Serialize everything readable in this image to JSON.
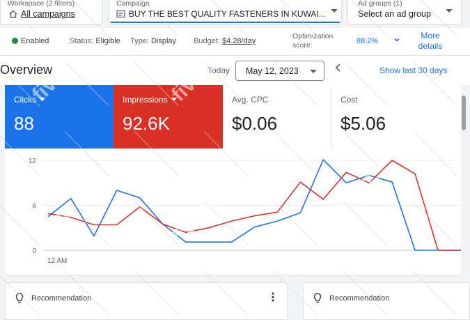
{
  "selectors": {
    "workspace": {
      "caption": "Workspace (2 filters)",
      "value": "All campaigns"
    },
    "campaign": {
      "caption": "Campaign",
      "value": "BUY THE BEST QUALITY FASTENERS IN KUWAI..."
    },
    "ad_groups": {
      "caption": "Ad groups (1)",
      "value": "Select an ad group"
    }
  },
  "status": {
    "enabled": "Enabled",
    "status_label": "Status:",
    "status_value": "Eligible",
    "type_label": "Type:",
    "type_value": "Display",
    "budget_label": "Budget:",
    "budget_value": "$4.28/day",
    "optimization_label": "Optimization score:",
    "optimization_value": "88.2%",
    "more_details": "More details"
  },
  "overview": {
    "title": "Overview",
    "today": "Today",
    "date": "May 12, 2023",
    "show_last": "Show last 30 days"
  },
  "metrics": [
    {
      "label": "Clicks",
      "value": "88"
    },
    {
      "label": "Impressions",
      "value": "92.6K"
    },
    {
      "label": "Avg. CPC",
      "value": "$0.06"
    },
    {
      "label": "Cost",
      "value": "$5.06"
    }
  ],
  "colors": {
    "clicks": "#1a73e8",
    "impressions": "#d93025",
    "enabled": "#1e8e3e",
    "link": "#1a73e8"
  },
  "chart_data": {
    "type": "line",
    "x": [
      0,
      1,
      2,
      3,
      4,
      5,
      6,
      7,
      8,
      9,
      10,
      11,
      12,
      13,
      14,
      15,
      16,
      17,
      18
    ],
    "xlabel_first": "12 AM",
    "yticks": [
      "12",
      "6",
      "0"
    ],
    "ylim": [
      0,
      12
    ],
    "grid": true,
    "series": [
      {
        "name": "Clicks",
        "values": [
          4.5,
          6.9,
          1.9,
          8.0,
          7.0,
          3.5,
          1.1,
          1.1,
          1.1,
          3.1,
          3.9,
          5.0,
          12.1,
          9.0,
          10.0,
          9.1,
          0,
          0,
          0
        ]
      },
      {
        "name": "Impressions",
        "values": [
          4.9,
          4.4,
          3.4,
          3.4,
          5.8,
          3.5,
          2.4,
          3.0,
          3.9,
          4.6,
          5.1,
          9.1,
          6.8,
          10.4,
          9.0,
          12.0,
          10.2,
          0,
          0
        ]
      }
    ]
  },
  "recommendations": [
    {
      "label": "Recommendation"
    },
    {
      "label": "Recommendation"
    }
  ],
  "watermark": "fiverr."
}
